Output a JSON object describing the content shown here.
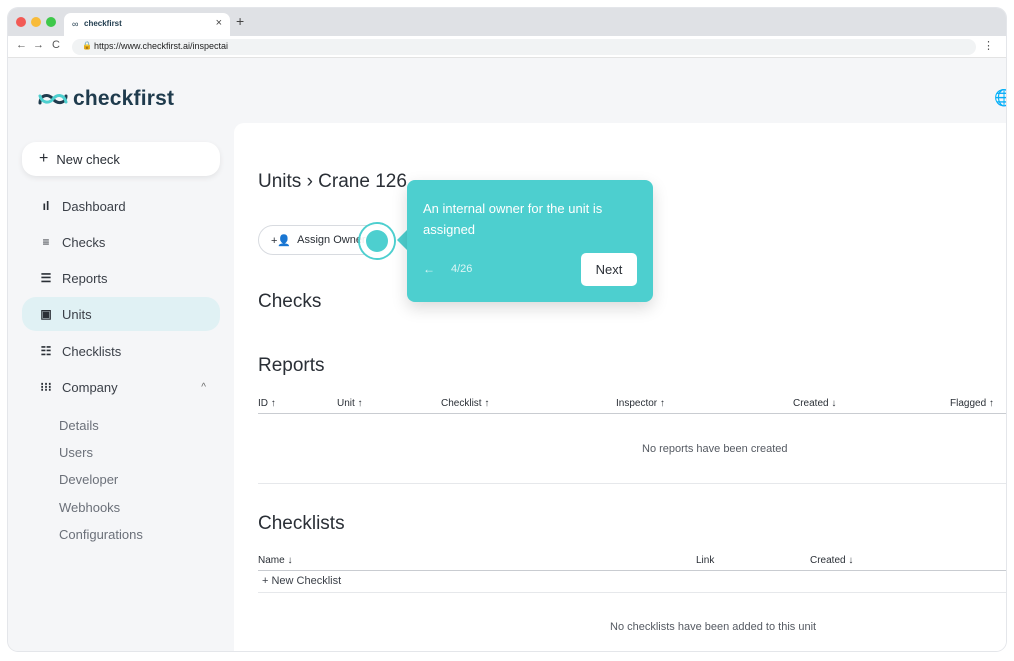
{
  "browser": {
    "tab_title": "checkfirst",
    "tab_close": "×",
    "new_tab": "+",
    "url": "https://www.checkfirst.ai/inspectai",
    "menu": "⋮"
  },
  "app": {
    "logo_text": "checkfirst",
    "brand_color": "#1f3b4d",
    "accent_color": "#4dcfcf"
  },
  "sidebar": {
    "new_check": "New check",
    "items": [
      {
        "label": "Dashboard",
        "icon": "bar-chart-icon"
      },
      {
        "label": "Checks",
        "icon": "checks-icon"
      },
      {
        "label": "Reports",
        "icon": "reports-icon"
      },
      {
        "label": "Units",
        "icon": "units-icon",
        "active": true
      },
      {
        "label": "Checklists",
        "icon": "checklists-icon"
      },
      {
        "label": "Company",
        "icon": "grid-icon",
        "expanded": true
      }
    ],
    "company_sub": [
      "Details",
      "Users",
      "Developer",
      "Webhooks",
      "Configurations"
    ]
  },
  "main": {
    "breadcrumb": "Units › Crane 126 -",
    "assign_owner": "Assign Owner",
    "checks_title": "Checks",
    "reports_title": "Reports",
    "reports_columns": [
      "ID ↑",
      "Unit ↑",
      "Checklist ↑",
      "Inspector ↑",
      "Created ↓",
      "Flagged ↑"
    ],
    "reports_empty": "No reports have been created",
    "checklists_title": "Checklists",
    "checklists_columns": [
      "Name ↓",
      "Link",
      "Created ↓"
    ],
    "new_checklist": "New Checklist",
    "checklists_empty": "No checklists have been added to this unit"
  },
  "tooltip": {
    "text": "An internal owner for the unit is assigned",
    "back": "←",
    "count": "4/26",
    "next": "Next"
  }
}
